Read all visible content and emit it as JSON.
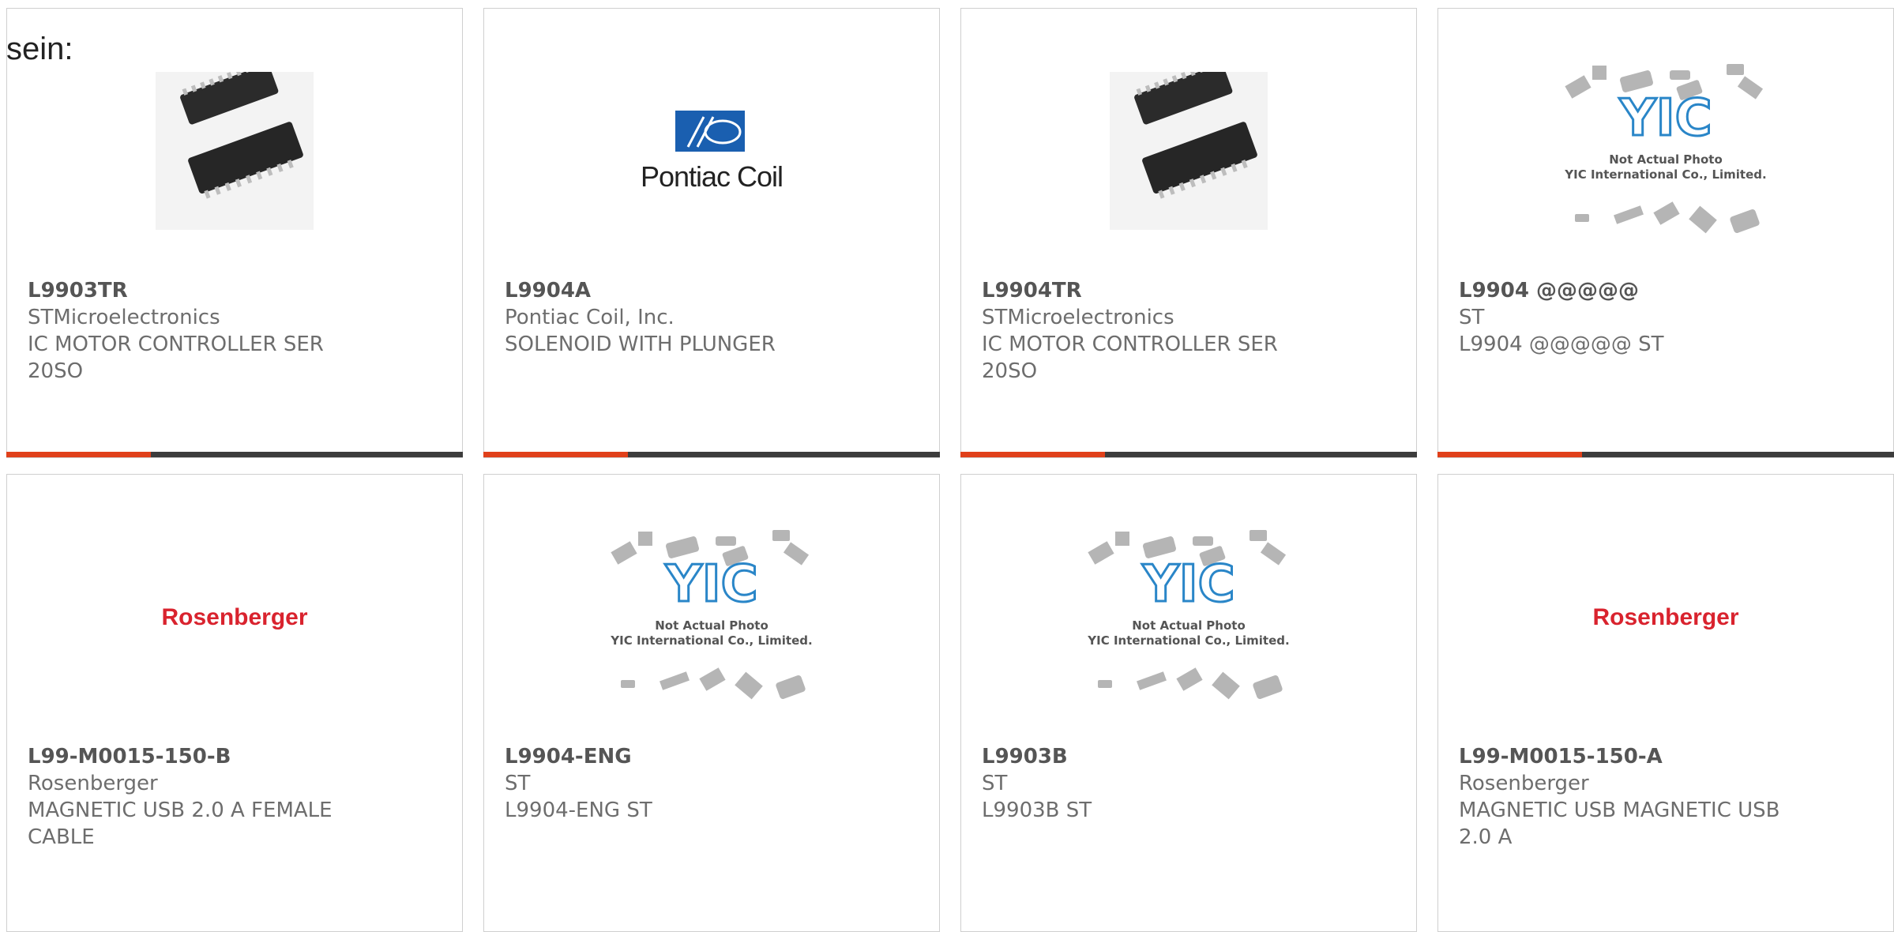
{
  "heading": "sein:",
  "colors": {
    "accent": "#e0401a",
    "bar": "#3c3c3c",
    "brand_red": "#d9232e",
    "logo_blue": "#1a5fb0"
  },
  "cards": [
    {
      "part": "L9903TR",
      "maker": "STMicroelectronics",
      "desc": "IC MOTOR CONTROLLER SER\n20SO",
      "image": "ic-chip-photo"
    },
    {
      "part": "L9904A",
      "maker": "Pontiac Coil, Inc.",
      "desc": "SOLENOID WITH PLUNGER",
      "image": "pontiac-coil-logo",
      "logo_text": "Pontiac Coil"
    },
    {
      "part": "L9904TR",
      "maker": "STMicroelectronics",
      "desc": "IC MOTOR CONTROLLER SER\n20SO",
      "image": "ic-chip-photo"
    },
    {
      "part": "L9904 @@@@@",
      "maker": "ST",
      "desc": "L9904 @@@@@ ST",
      "image": "yic-placeholder",
      "placeholder_line1": "Not Actual Photo",
      "placeholder_line2": "YIC International Co., Limited."
    },
    {
      "part": "L99-M0015-150-B",
      "maker": "Rosenberger",
      "desc": "MAGNETIC USB 2.0 A FEMALE\nCABLE",
      "image": "rosenberger-logo",
      "logo_text": "Rosenberger"
    },
    {
      "part": "L9904-ENG",
      "maker": "ST",
      "desc": "L9904-ENG ST",
      "image": "yic-placeholder",
      "placeholder_line1": "Not Actual Photo",
      "placeholder_line2": "YIC International Co., Limited."
    },
    {
      "part": "L9903B",
      "maker": "ST",
      "desc": "L9903B ST",
      "image": "yic-placeholder",
      "placeholder_line1": "Not Actual Photo",
      "placeholder_line2": "YIC International Co., Limited."
    },
    {
      "part": "L99-M0015-150-A",
      "maker": "Rosenberger",
      "desc": "MAGNETIC USB MAGNETIC USB\n2.0 A",
      "image": "rosenberger-logo",
      "logo_text": "Rosenberger"
    }
  ]
}
